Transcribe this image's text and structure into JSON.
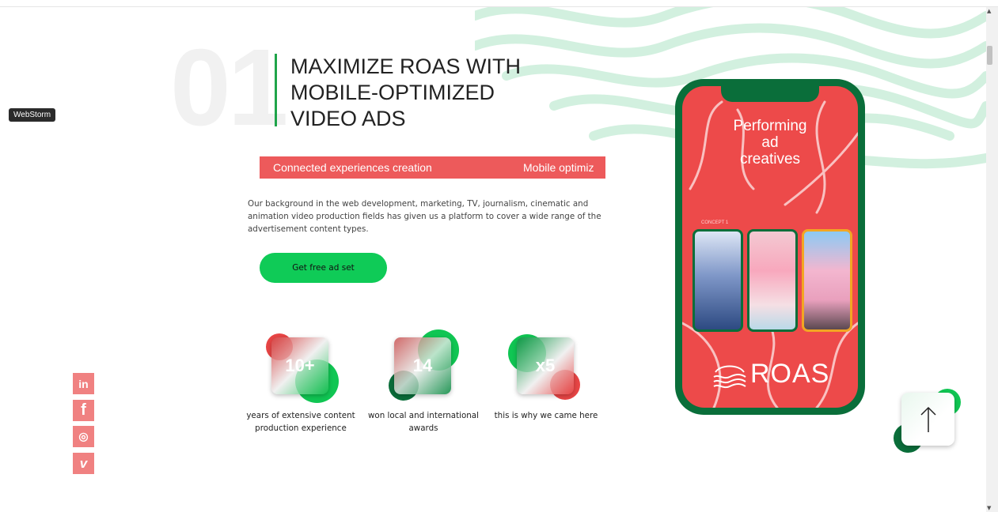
{
  "tooltip": "WebStorm",
  "section": {
    "number": "01",
    "heading_lines": [
      "MAXIMIZE ROAS WITH",
      "MOBILE-OPTIMIZED",
      "VIDEO ADS"
    ],
    "marquee": [
      "Connected experiences creation",
      "Mobile optimiz"
    ],
    "description": "Our background in the web development, marketing, TV, journalism, cinematic and animation video production fields has given us a platform to cover a wide range of the advertisement content types.",
    "cta_label": "Get free ad set"
  },
  "stats": [
    {
      "value": "10+",
      "label": "years of extensive content production experience"
    },
    {
      "value": "14",
      "label": "won local and international awards"
    },
    {
      "value": "x5",
      "label": "this is why we came here"
    }
  ],
  "social": {
    "linkedin": "in",
    "facebook": "f",
    "instagram": "◎",
    "vimeo": "v"
  },
  "phone": {
    "title_lines": [
      "Performing",
      "ad",
      "creatives"
    ],
    "concept_label": "CONCEPT 1",
    "brand": "ROAS"
  },
  "colors": {
    "accent_green": "#0fcb57",
    "dark_green": "#0a6e3a",
    "coral": "#ed5a5b",
    "wave": "#cfeedd"
  },
  "icons": [
    "linkedin-icon",
    "facebook-icon",
    "instagram-icon",
    "vimeo-icon",
    "arrow-up-icon"
  ]
}
